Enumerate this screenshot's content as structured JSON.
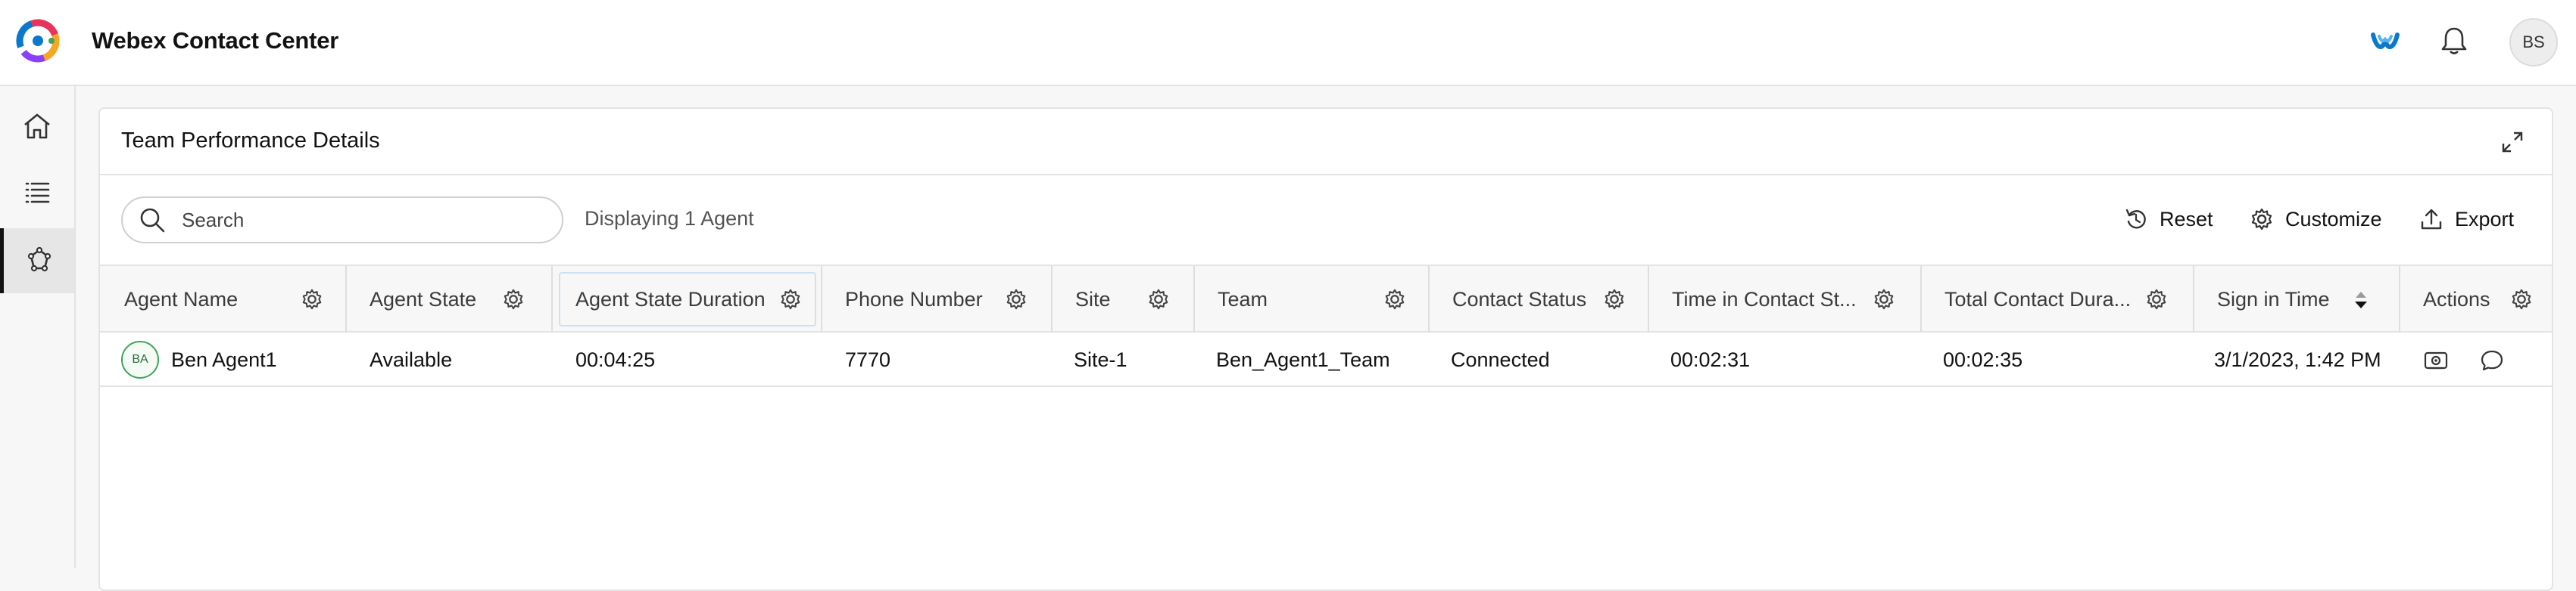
{
  "app": {
    "title": "Webex Contact Center",
    "user_initials": "BS"
  },
  "sidebar": {
    "items": [
      {
        "name": "home",
        "icon": "home-icon"
      },
      {
        "name": "tasks",
        "icon": "list-icon"
      },
      {
        "name": "team-performance",
        "icon": "team-icon",
        "active": true
      }
    ]
  },
  "panel": {
    "title": "Team Performance Details",
    "search_placeholder": "Search",
    "displaying": "Displaying 1 Agent",
    "reset_label": "Reset",
    "customize_label": "Customize",
    "export_label": "Export"
  },
  "table": {
    "columns": [
      "Agent Name",
      "Agent State",
      "Agent State Duration",
      "Phone Number",
      "Site",
      "Team",
      "Contact Status",
      "Time in Contact St...",
      "Total Contact Dura...",
      "Sign in Time",
      "Actions"
    ],
    "rows": [
      {
        "initials": "BA",
        "agent_name": "Ben Agent1",
        "agent_state": "Available",
        "agent_state_duration": "00:04:25",
        "phone_number": "7770",
        "site": "Site-1",
        "team": "Ben_Agent1_Team",
        "contact_status": "Connected",
        "time_in_contact_state": "00:02:31",
        "total_contact_duration": "00:02:35",
        "sign_in_time": "3/1/2023, 1:42 PM"
      }
    ]
  },
  "colors": {
    "accent_active": "#121212",
    "agent_avatar_border": "#3fa35b",
    "highlight_border": "#cfe0f2"
  }
}
